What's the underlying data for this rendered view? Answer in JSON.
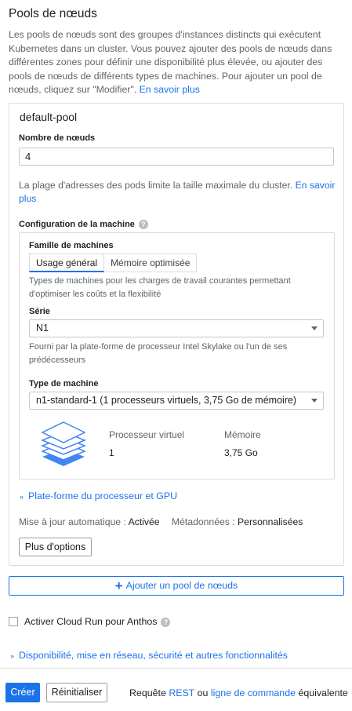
{
  "section": {
    "title": "Pools de nœuds",
    "intro": "Les pools de nœuds sont des groupes d'instances distincts qui exécutent Kubernetes dans un cluster. Vous pouvez ajouter des pools de nœuds dans différentes zones pour définir une disponibilité plus élevée, ou ajouter des pools de nœuds de différents types de machines. Pour ajouter un pool de nœuds, cliquez sur \"Modifier\".",
    "learn_more": "En savoir plus"
  },
  "pool": {
    "name": "default-pool",
    "node_count_label": "Nombre de nœuds",
    "node_count_value": "4",
    "pod_range_note": "La plage d'adresses des pods limite la taille maximale du cluster.",
    "pod_range_link": "En savoir plus",
    "machine_config_label": "Configuration de la machine",
    "help_glyph": "?",
    "machine": {
      "family_label": "Famille de machines",
      "families": [
        "Usage général",
        "Mémoire optimisée"
      ],
      "selected_family": "Usage général",
      "family_desc": "Types de machines pour les charges de travail courantes permettant d'optimiser les coûts et la flexibilité",
      "series_label": "Série",
      "series_value": "N1",
      "series_desc": "Fourni par la plate-forme de processeur Intel Skylake ou l'un de ses prédécesseurs",
      "type_label": "Type de machine",
      "type_value": "n1-standard-1 (1 processeurs virtuels, 3,75 Go de mémoire)",
      "vcpu_label": "Processeur virtuel",
      "vcpu_value": "1",
      "memory_label": "Mémoire",
      "memory_value": "3,75 Go",
      "icon": "stack-icon"
    },
    "cpu_platform_expander": "Plate-forme du processeur et GPU",
    "auto_upgrade_key": "Mise à jour automatique :",
    "auto_upgrade_value": "Activée",
    "metadata_key": "Métadonnées :",
    "metadata_value": "Personnalisées",
    "more_options": "Plus d'options"
  },
  "add_pool": "Ajouter un pool de nœuds",
  "cloud_run": {
    "label": "Activer Cloud Run pour Anthos",
    "checked": false
  },
  "availability_expander": "Disponibilité, mise en réseau, sécurité et autres fonctionnalités",
  "footer": {
    "create": "Créer",
    "reset": "Réinitialiser",
    "request_prefix": "Requête",
    "rest_link": "REST",
    "or": "ou",
    "cli_link": "ligne de commande",
    "suffix": "équivalente"
  },
  "colors": {
    "accent": "#1a73e8",
    "icon_blue": "#4285f4"
  }
}
